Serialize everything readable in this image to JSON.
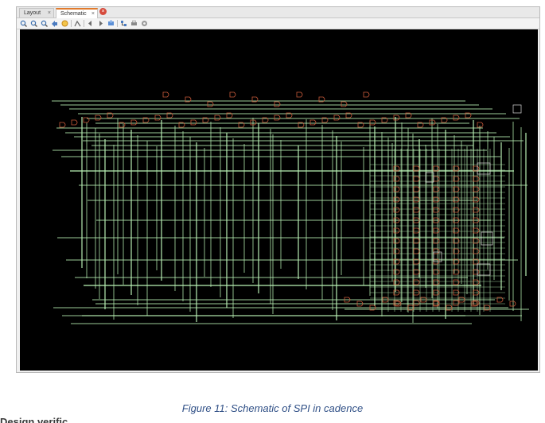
{
  "tabs": [
    {
      "label": "Layout",
      "active": false
    },
    {
      "label": "Schematic",
      "active": true
    }
  ],
  "tab_close_glyph": "×",
  "close_all_glyph": "×",
  "toolbar": {
    "icons": [
      "zoom-in-icon",
      "zoom-out-icon",
      "zoom-fit-icon",
      "zoom-back-icon",
      "highlight-icon",
      "route-icon",
      "previous-icon",
      "next-icon",
      "regenerate-icon",
      "hierarchy-icon",
      "print-icon",
      "settings-icon"
    ]
  },
  "colors": {
    "wire": "#b8f0b4",
    "cell": "#c85a3a",
    "canvas": "#000000",
    "accent": "#e07a2c"
  },
  "caption": "Figure 11: Schematic of SPI in cadence",
  "partial_text": "Design verific"
}
